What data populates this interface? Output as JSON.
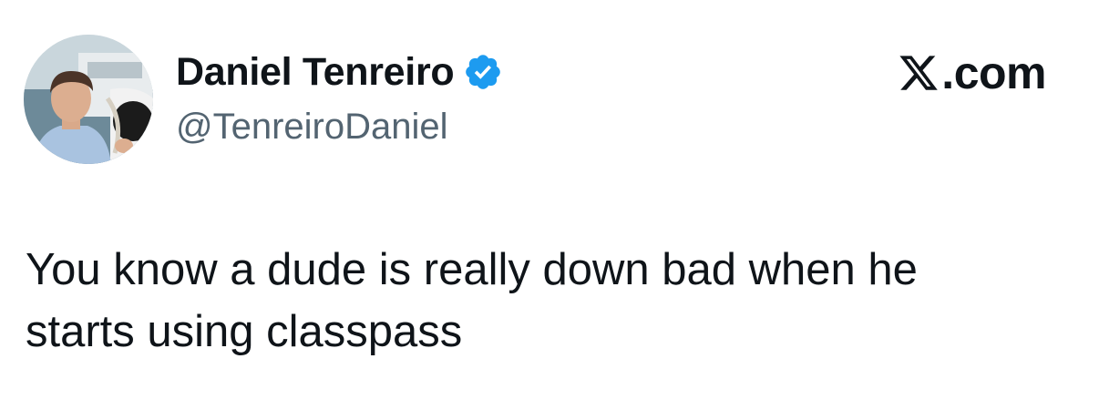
{
  "author": {
    "display_name": "Daniel Tenreiro",
    "handle": "@TenreiroDaniel",
    "verified": true,
    "avatar_icon": "profile-photo"
  },
  "brand": {
    "icon": "x-logo-icon",
    "text": ".com"
  },
  "tweet": {
    "lines": [
      "You know a dude is really down bad when he",
      "starts using classpass"
    ]
  },
  "colors": {
    "text_primary": "#0f1419",
    "text_secondary": "#536471",
    "verified_blue": "#1d9bf0",
    "background": "#ffffff"
  }
}
